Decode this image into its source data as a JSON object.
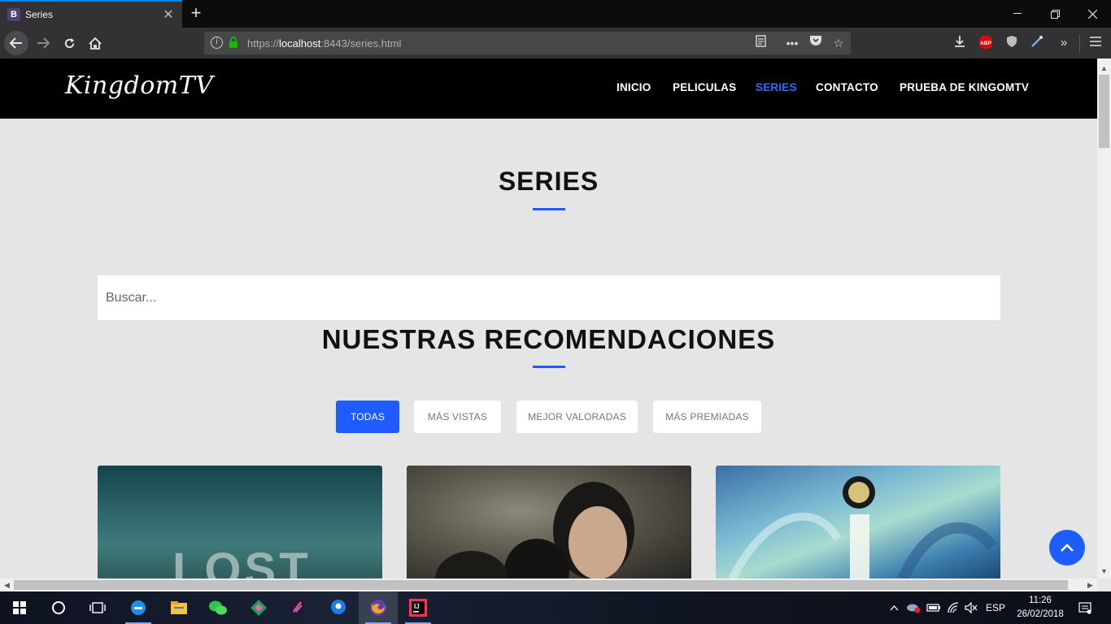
{
  "browser": {
    "tab_title": "Series",
    "tab_favicon_letter": "B",
    "url_scheme": "https://",
    "url_host": "localhost",
    "url_rest": ":8443/series.html",
    "extension_badge": "ABP"
  },
  "site": {
    "logo": "KingdomTV",
    "nav": {
      "inicio": "INICIO",
      "peliculas": "PELICULAS",
      "series": "SERIES",
      "contacto": "CONTACTO",
      "prueba": "PRUEBA DE KINGOMTV"
    },
    "active_nav": "SERIES",
    "accent_color": "#1f5cff"
  },
  "main": {
    "page_title": "SERIES",
    "search_placeholder": "Buscar...",
    "recommendations_title": "NUESTRAS RECOMENDACIONES",
    "filters": {
      "todas": "TODAS",
      "mas_vistas": "MÁS VISTAS",
      "mejor_valoradas": "MEJOR VALORADAS",
      "mas_premiadas": "MÁS PREMIADAS"
    },
    "active_filter": "TODAS",
    "cards": {
      "lost_text": "LOST"
    }
  },
  "taskbar": {
    "language": "ESP",
    "time": "11:26",
    "date": "26/02/2018"
  }
}
